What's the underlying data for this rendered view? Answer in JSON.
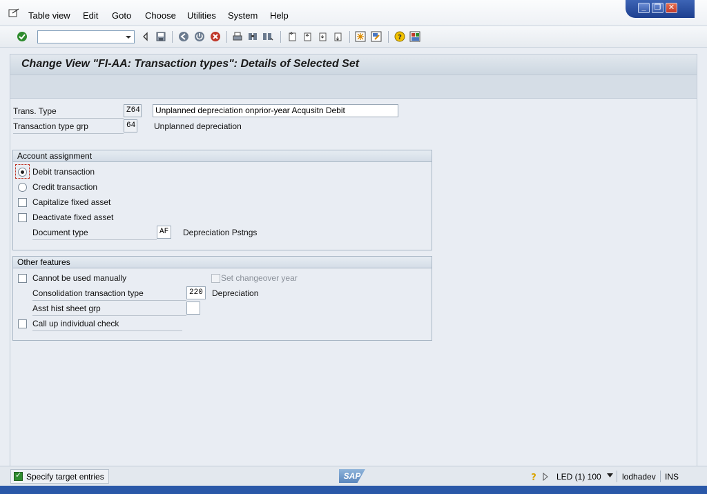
{
  "menu": {
    "items": [
      "Table view",
      "Edit",
      "Goto",
      "Choose",
      "Utilities",
      "System",
      "Help"
    ]
  },
  "toolbar": {
    "command_field_value": "",
    "icons": [
      "enter-icon",
      "back-nav-icon",
      "save-icon",
      "back-icon",
      "exit-icon",
      "cancel-icon",
      "print-icon",
      "find-icon",
      "find-next-icon",
      "first-page-icon",
      "previous-page-icon",
      "next-page-icon",
      "last-page-icon",
      "create-session-icon",
      "shortcut-icon",
      "help-icon",
      "layout-menu-icon"
    ]
  },
  "title": "Change View \"FI-AA: Transaction types\": Details of Selected Set",
  "trans_type": {
    "label": "Trans. Type",
    "code": "Z64",
    "description": "Unplanned depreciation onprior-year Acqusitn Debit"
  },
  "trans_type_grp": {
    "label": "Transaction type grp",
    "code": "64",
    "description": "Unplanned depreciation"
  },
  "account_assignment": {
    "title": "Account assignment",
    "debit": "Debit transaction",
    "credit": "Credit transaction",
    "selected": "debit",
    "capitalize": "Capitalize fixed asset",
    "deactivate": "Deactivate fixed asset",
    "doc_type_label": "Document type",
    "doc_type_value": "AF",
    "doc_type_desc": "Depreciation Pstngs"
  },
  "other_features": {
    "title": "Other features",
    "cannot_manual": "Cannot be used manually",
    "changeover": "Set changeover year",
    "consol_label": "Consolidation transaction type",
    "consol_value": "220",
    "consol_desc": "Depreciation",
    "asst_hist_label": "Asst hist sheet grp",
    "asst_hist_value": "",
    "call_up": "Call up individual check"
  },
  "status": {
    "message": "Specify target entries",
    "system": "LED (1) 100",
    "user": "lodhadev",
    "mode": "INS"
  },
  "colors": {
    "title_blue": "#2a58a8",
    "accept_green": "#2e8b2e"
  }
}
